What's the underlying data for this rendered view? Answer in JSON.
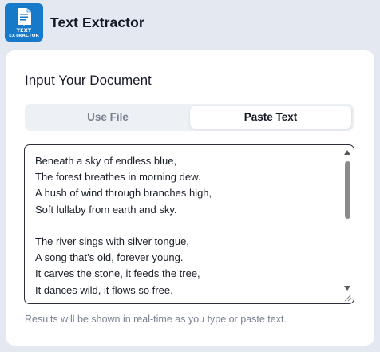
{
  "app": {
    "title": "Text Extractor",
    "logo_line1": "TEXT",
    "logo_line2": "EXTRACTOR",
    "logo_icon": "document-extract-icon",
    "brand_color": "#1679c9"
  },
  "section": {
    "title": "Input Your Document"
  },
  "tabs": [
    {
      "label": "Use File",
      "active": false
    },
    {
      "label": "Paste Text",
      "active": true
    }
  ],
  "textarea": {
    "lines": [
      "Beneath a sky of endless blue,",
      "The forest breathes in morning dew.",
      "A hush of wind through branches high,",
      "Soft lullaby from earth and sky.",
      "",
      "The river sings with silver tongue,",
      "A song that’s old, forever young.",
      "It carves the stone, it feeds the tree,",
      "It dances wild, it flows so free."
    ]
  },
  "hint": "Results will be shown in real-time as you type or paste text."
}
